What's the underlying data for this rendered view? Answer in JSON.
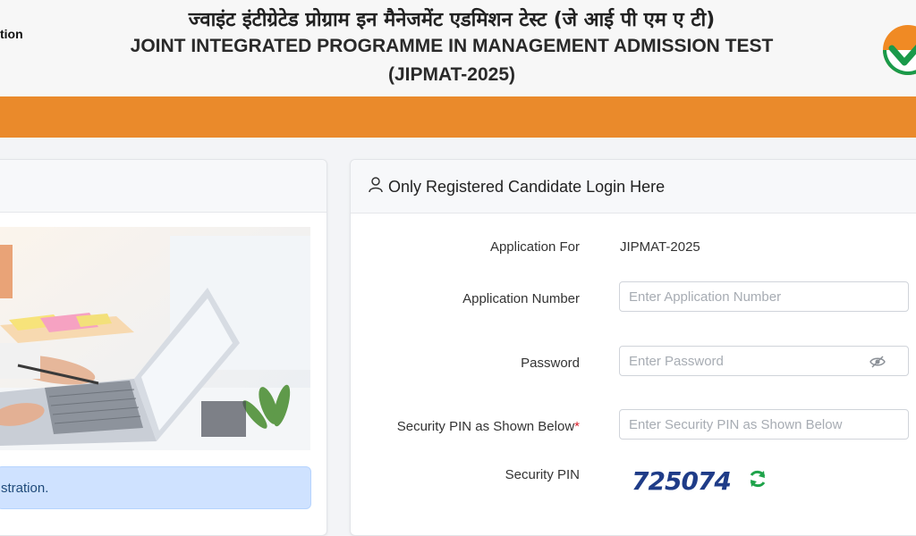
{
  "header": {
    "left_logo_text": "tion",
    "title_hindi": "ज्वाइंट इंटीग्रेटेड प्रोग्राम इन मैनेजमेंट एडमिशन टेस्ट (जे आई पी एम ए टी)",
    "title_english": "JOINT INTEGRATED PROGRAMME IN MANAGEMENT ADMISSION TEST",
    "subtitle": "(JIPMAT-2025)",
    "emblem_icon": "tricolor-check-emblem-icon"
  },
  "left_panel": {
    "alert_text": "stration."
  },
  "login": {
    "title": "Only Registered Candidate Login Here",
    "application_for_label": "Application For",
    "application_for_value": "JIPMAT-2025",
    "application_number_label": "Application Number",
    "application_number_placeholder": "Enter Application Number",
    "password_label": "Password",
    "password_placeholder": "Enter Password",
    "security_pin_input_label": "Security PIN as Shown Below",
    "required_mark": "*",
    "security_pin_placeholder": "Enter Security PIN as Shown Below",
    "security_pin_label": "Security PIN",
    "captcha_value": "725074"
  },
  "colors": {
    "orange_band": "#ea8a2b",
    "captcha_text": "#1f3c88",
    "refresh_icon": "#1fa34a",
    "required": "#d9232d"
  }
}
